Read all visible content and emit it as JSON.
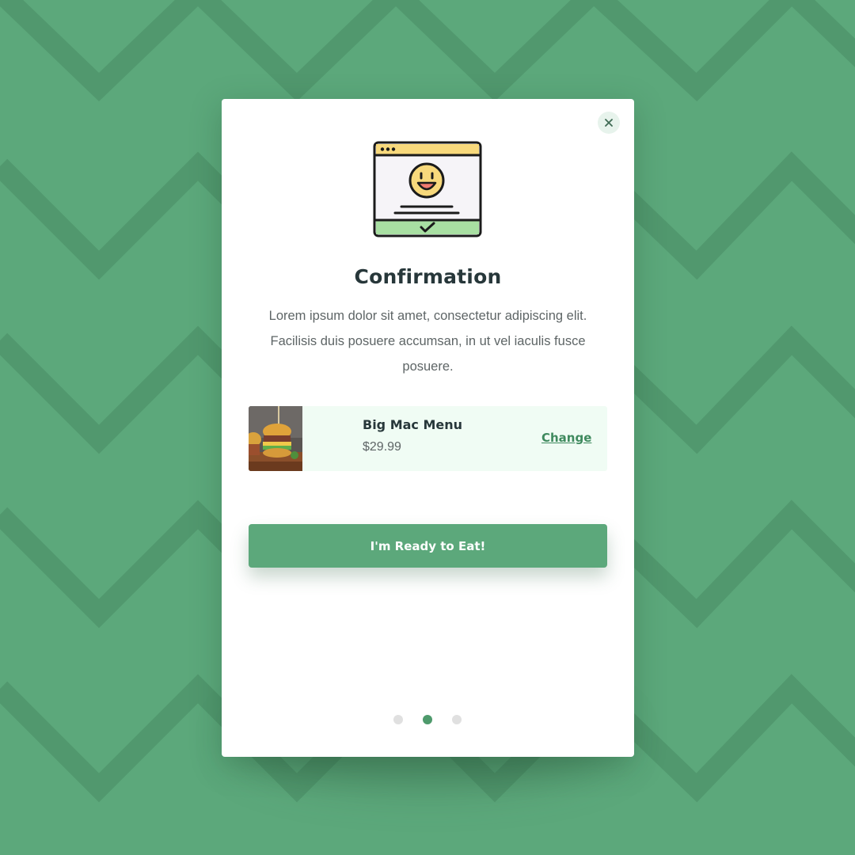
{
  "dialog": {
    "title": "Confirmation",
    "description": "Lorem ipsum dolor sit amet, consectetur adipiscing elit. Facilisis duis posuere accumsan, in ut vel iaculis fusce posuere.",
    "close_icon": "close-icon",
    "hero_icon": "smiley-browser-check-icon"
  },
  "order_item": {
    "name": "Big Mac Menu",
    "price": "$29.99",
    "change_label": "Change",
    "image": "burger-photo"
  },
  "cta": {
    "label": "I'm Ready to Eat!"
  },
  "pagination": {
    "count": 3,
    "active_index": 1
  },
  "colors": {
    "background": "#5ca87b",
    "accent": "#5ca87b",
    "title_text": "#27373a",
    "body_text": "#5e6566",
    "item_bg": "#f0fcf4"
  }
}
